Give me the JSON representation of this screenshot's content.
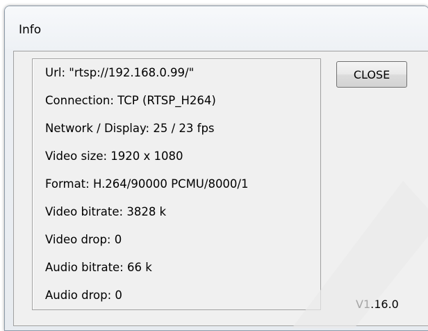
{
  "window": {
    "title": "Info"
  },
  "info": {
    "lines": [
      "Url: \"rtsp://192.168.0.99/\"",
      "Connection: TCP (RTSP_H264)",
      "Network / Display:  25 / 23 fps",
      "Video size: 1920 x 1080",
      "Format: H.264/90000 PCMU/8000/1",
      "Video bitrate: 3828 k",
      "Video drop: 0",
      "Audio bitrate: 66 k",
      "Audio drop: 0"
    ]
  },
  "buttons": {
    "close_label": "CLOSE"
  },
  "version": "V1.16.0",
  "colors": {
    "window_bg": "#f0f0f0",
    "border": "#a0a0a0",
    "watermark": "#e6e6e6"
  }
}
